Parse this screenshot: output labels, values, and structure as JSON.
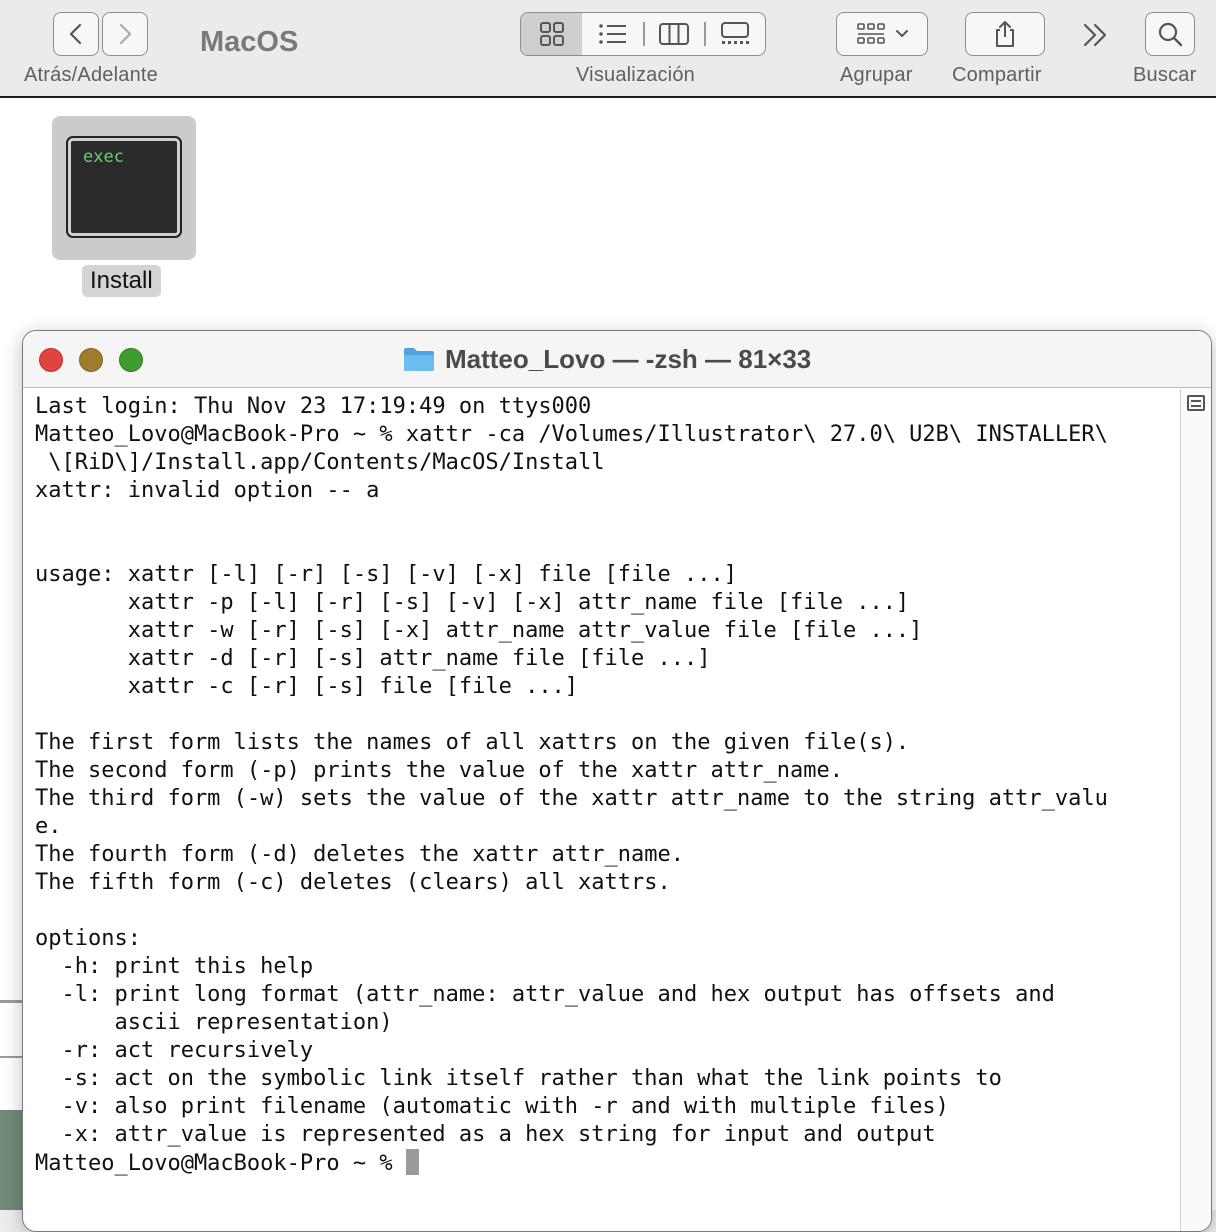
{
  "toolbar": {
    "nav_label": "Atrás/Adelante",
    "folder_title": "MacOS",
    "view_label": "Visualización",
    "group_label": "Agrupar",
    "share_label": "Compartir",
    "search_label": "Buscar",
    "icons": {
      "back": "chevron-left-icon",
      "forward": "chevron-right-icon",
      "icon_view": "grid-icon",
      "list_view": "list-icon",
      "column_view": "columns-icon",
      "gallery_view": "gallery-icon",
      "group": "group-grid-icon",
      "share": "share-icon",
      "more": "chevron-double-right-icon",
      "search": "magnifier-icon"
    }
  },
  "finder": {
    "file_name": "Install",
    "file_icon_text": "exec"
  },
  "terminal": {
    "title": "Matteo_Lovo — -zsh — 81×33",
    "prompt_final": "Matteo_Lovo@MacBook-Pro ~ % ",
    "lines": [
      "Last login: Thu Nov 23 17:19:49 on ttys000",
      "Matteo_Lovo@MacBook-Pro ~ % xattr -ca /Volumes/Illustrator\\ 27.0\\ U2B\\ INSTALLER\\",
      " \\[RiD\\]/Install.app/Contents/MacOS/Install",
      "xattr: invalid option -- a",
      "",
      "",
      "usage: xattr [-l] [-r] [-s] [-v] [-x] file [file ...]",
      "       xattr -p [-l] [-r] [-s] [-v] [-x] attr_name file [file ...]",
      "       xattr -w [-r] [-s] [-x] attr_name attr_value file [file ...]",
      "       xattr -d [-r] [-s] attr_name file [file ...]",
      "       xattr -c [-r] [-s] file [file ...]",
      "",
      "The first form lists the names of all xattrs on the given file(s).",
      "The second form (-p) prints the value of the xattr attr_name.",
      "The third form (-w) sets the value of the xattr attr_name to the string attr_valu",
      "e.",
      "The fourth form (-d) deletes the xattr attr_name.",
      "The fifth form (-c) deletes (clears) all xattrs.",
      "",
      "options:",
      "  -h: print this help",
      "  -l: print long format (attr_name: attr_value and hex output has offsets and",
      "      ascii representation)",
      "  -r: act recursively",
      "  -s: act on the symbolic link itself rather than what the link points to",
      "  -v: also print filename (automatic with -r and with multiple files)",
      "  -x: attr_value is represented as a hex string for input and output"
    ]
  },
  "colors": {
    "traffic_red": "#e0443e",
    "traffic_yellow": "#a07b2c",
    "traffic_green": "#3f9c2f",
    "exec_text": "#63d36a",
    "folder_blue": "#5aaee8"
  }
}
